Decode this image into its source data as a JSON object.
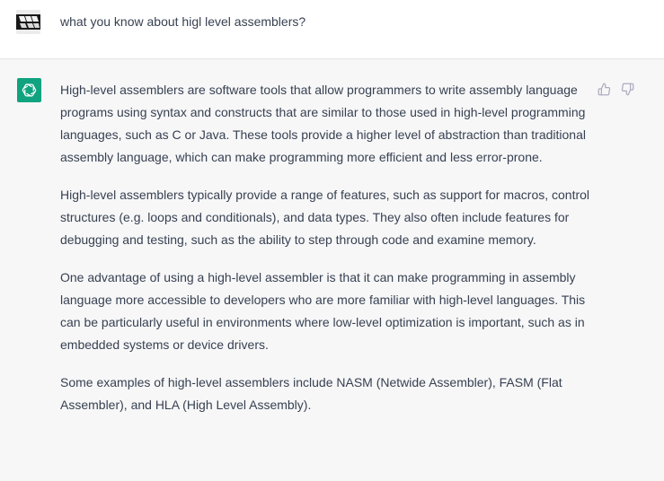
{
  "conversation": {
    "user_message": "what you know about higl level assemblers?",
    "assistant_paragraphs": [
      "High-level assemblers are software tools that allow programmers to write assembly language programs using syntax and constructs that are similar to those used in high-level programming languages, such as C or Java. These tools provide a higher level of abstraction than traditional assembly language, which can make programming more efficient and less error-prone.",
      "High-level assemblers typically provide a range of features, such as support for macros, control structures (e.g. loops and conditionals), and data types. They also often include features for debugging and testing, such as the ability to step through code and examine memory.",
      "One advantage of using a high-level assembler is that it can make programming in assembly language more accessible to developers who are more familiar with high-level languages. This can be particularly useful in environments where low-level optimization is important, such as in embedded systems or device drivers.",
      "Some examples of high-level assemblers include NASM (Netwide Assembler), FASM (Flat Assembler), and HLA (High Level Assembly)."
    ]
  },
  "icons": {
    "assistant_avatar": "openai-logo-icon",
    "thumbs_up": "thumbs-up-icon",
    "thumbs_down": "thumbs-down-icon"
  },
  "colors": {
    "assistant_avatar_bg": "#10a37f",
    "user_row_bg": "#ffffff",
    "assistant_row_bg": "#f7f7f8",
    "text": "#374151"
  }
}
